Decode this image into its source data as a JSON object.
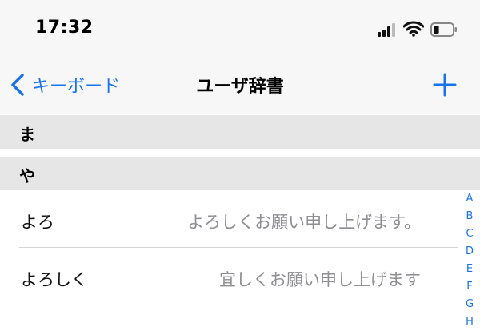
{
  "status_bar": {
    "time": "17:32",
    "signal_icon": "cellular-signal-icon",
    "wifi_icon": "wifi-icon",
    "battery_icon": "battery-icon",
    "battery_level": 0.3
  },
  "nav": {
    "back_label": "キーボード",
    "title": "ユーザ辞書",
    "add_icon": "plus-icon"
  },
  "sections": [
    {
      "header": "ま",
      "entries": []
    },
    {
      "header": "や",
      "entries": [
        {
          "reading": "よろ",
          "word": "よろしくお願い申し上げます。"
        },
        {
          "reading": "よろしく",
          "word": "宜しくお願い申し上げます"
        }
      ]
    }
  ],
  "index_letters": [
    "A",
    "B",
    "C",
    "D",
    "E",
    "F",
    "G",
    "H"
  ],
  "colors": {
    "accent": "#1a73e8",
    "section_bg": "#e6e6e6",
    "secondary_text": "#8e8e93"
  }
}
